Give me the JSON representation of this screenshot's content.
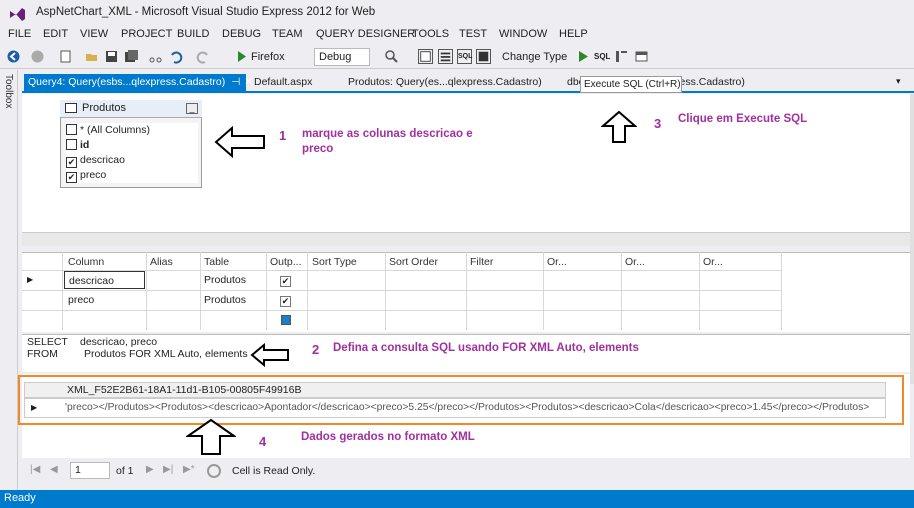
{
  "window": {
    "title": "AspNetChart_XML - Microsoft Visual Studio Express 2012 for Web"
  },
  "menu": [
    "FILE",
    "EDIT",
    "VIEW",
    "PROJECT",
    "BUILD",
    "DEBUG",
    "TEAM",
    "QUERY DESIGNER",
    "TOOLS",
    "TEST",
    "WINDOW",
    "HELP"
  ],
  "toolbar": {
    "browser": "Firefox",
    "config": "Debug",
    "change_type": "Change Type"
  },
  "toolbox": {
    "label": "Toolbox"
  },
  "tabs": [
    {
      "label": "Query4: Query(esbs...qlexpress.Cadastro)",
      "active": true
    },
    {
      "label": "Default.aspx"
    },
    {
      "label": "Produtos: Query(es...qlexpress.Cadastro)"
    },
    {
      "label": "dbo"
    },
    {
      "label": "ress.Cadastro)"
    }
  ],
  "tooltip": "Execute SQL (Ctrl+R)",
  "diagram": {
    "table_name": "Produtos",
    "columns": [
      {
        "label": "* (All Columns)",
        "checked": false
      },
      {
        "label": "id",
        "checked": false
      },
      {
        "label": "descricao",
        "checked": true
      },
      {
        "label": "preco",
        "checked": true
      }
    ]
  },
  "annotations": {
    "n1": "1",
    "t1a": "marque as colunas descricao e",
    "t1b": "preco",
    "n2": "2",
    "t2": "Defina a consulta SQL usando FOR XML Auto, elements",
    "n3": "3",
    "t3": "Clique em Execute SQL",
    "n4": "4",
    "t4": "Dados gerados no formato XML"
  },
  "grid": {
    "headers": [
      "Column",
      "Alias",
      "Table",
      "Outp...",
      "Sort Type",
      "Sort Order",
      "Filter",
      "Or...",
      "Or...",
      "Or..."
    ],
    "rows": [
      {
        "column": "descricao",
        "table": "Produtos",
        "output": true
      },
      {
        "column": "preco",
        "table": "Produtos",
        "output": true
      }
    ]
  },
  "sql": {
    "select_kw": "SELECT",
    "select_val": "descricao, preco",
    "from_kw": "FROM",
    "from_val": "Produtos FOR XML Auto, elements"
  },
  "results": {
    "header": "XML_F52E2B61-18A1-11d1-B105-00805F49916B",
    "value": "'preco></Produtos><Produtos><descricao>Apontador</descricao><preco>5.25</preco></Produtos><Produtos><descricao>Cola</descricao><preco>1.45</preco></Produtos>"
  },
  "nav": {
    "page": "1",
    "of": "of 1",
    "readonly": "Cell is Read Only."
  },
  "status": "Ready",
  "colors": {
    "accent": "#007acc",
    "annotation": "#a0309f",
    "highlight": "#f08a24"
  }
}
